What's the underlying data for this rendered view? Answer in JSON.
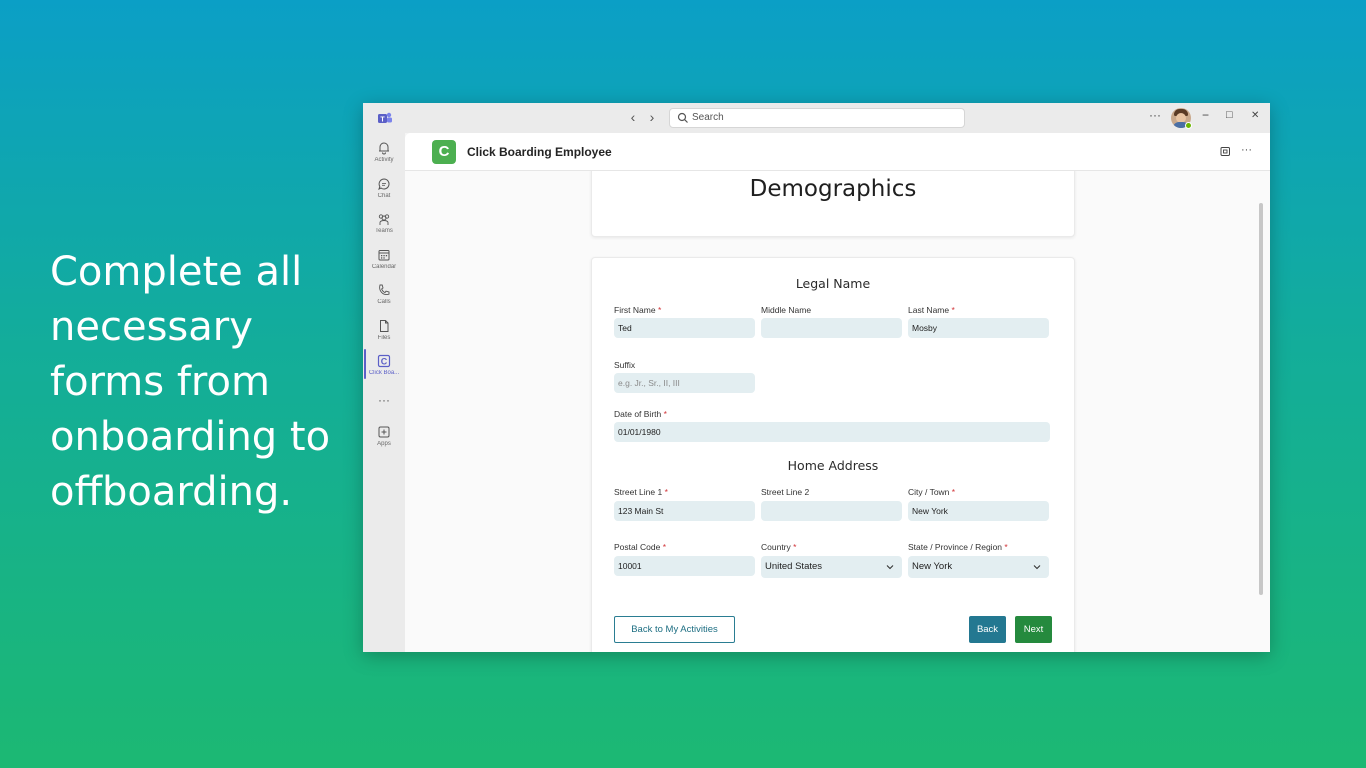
{
  "marketing": {
    "tagline": "Complete all necessary forms from onboarding to offboarding."
  },
  "titlebar": {
    "search_placeholder": "Search",
    "more_label": "···",
    "minimize_label": "−",
    "maximize_label": "□",
    "close_label": "✕",
    "back_arrow": "‹",
    "forward_arrow": "›"
  },
  "rail": {
    "items": [
      {
        "label": "Activity",
        "icon": "bell-icon"
      },
      {
        "label": "Chat",
        "icon": "chat-icon"
      },
      {
        "label": "Teams",
        "icon": "teams-icon"
      },
      {
        "label": "Calendar",
        "icon": "calendar-icon"
      },
      {
        "label": "Calls",
        "icon": "phone-icon"
      },
      {
        "label": "Files",
        "icon": "file-icon"
      },
      {
        "label": "Click Boa...",
        "icon": "click-boarding-icon"
      },
      {
        "label": "",
        "icon": "more-icon"
      },
      {
        "label": "Apps",
        "icon": "add-app-icon"
      }
    ],
    "more_dots": "···",
    "active_color": "#5b5fc7"
  },
  "app": {
    "logo_letter": "C",
    "title": "Click Boarding Employee",
    "brand_color": "#4caf50",
    "more_label": "···"
  },
  "page": {
    "title": "Demographics"
  },
  "form": {
    "legal_name_title": "Legal Name",
    "home_address_title": "Home Address",
    "required_mark": "*",
    "first_name": {
      "label": "First Name",
      "value": "Ted"
    },
    "middle_name": {
      "label": "Middle Name",
      "value": ""
    },
    "last_name": {
      "label": "Last Name",
      "value": "Mosby"
    },
    "suffix": {
      "label": "Suffix",
      "placeholder": "e.g. Jr., Sr., II, III"
    },
    "dob": {
      "label": "Date of Birth",
      "value": "01/01/1980"
    },
    "street1": {
      "label": "Street Line 1",
      "value": "123 Main St"
    },
    "street2": {
      "label": "Street Line 2",
      "value": ""
    },
    "city": {
      "label": "City / Town",
      "value": "New York"
    },
    "postal": {
      "label": "Postal Code",
      "value": "10001"
    },
    "country": {
      "label": "Country",
      "value": "United States"
    },
    "state": {
      "label": "State / Province / Region",
      "value": "New York"
    }
  },
  "buttons": {
    "back_to_activities": "Back to My Activities",
    "back": "Back",
    "next": "Next"
  }
}
